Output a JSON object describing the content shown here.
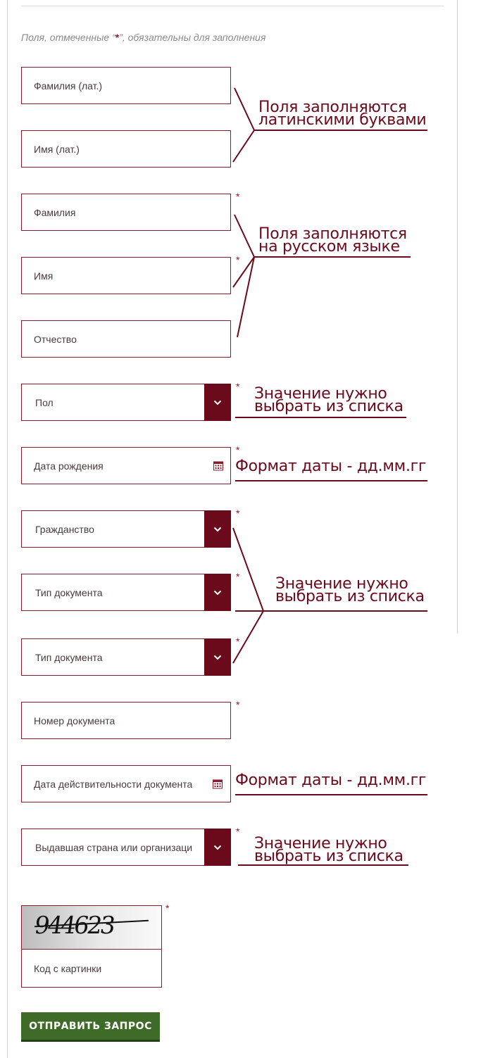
{
  "form": {
    "required_note_prefix": "Поля, отмеченные “",
    "required_note_star": "*",
    "required_note_suffix": "”, обязательны для заполнения",
    "required_marker": "*",
    "fields": {
      "last_name_lat": {
        "label": "Фамилия (лат.)",
        "required": false
      },
      "first_name_lat": {
        "label": "Имя (лат.)",
        "required": false
      },
      "last_name": {
        "label": "Фамилия",
        "required": true
      },
      "first_name": {
        "label": "Имя",
        "required": true
      },
      "patronymic": {
        "label": "Отчество",
        "required": false
      },
      "sex": {
        "label": "Пол",
        "required": true,
        "type": "select"
      },
      "birth_date": {
        "label": "Дата рождения",
        "required": true,
        "type": "date"
      },
      "citizenship": {
        "label": "Гражданство",
        "required": true,
        "type": "select"
      },
      "doc_type_1": {
        "label": "Тип документа",
        "required": true,
        "type": "select"
      },
      "doc_type_2": {
        "label": "Тип документа",
        "required": true,
        "type": "select"
      },
      "doc_number": {
        "label": "Номер документа",
        "required": true
      },
      "doc_valid_date": {
        "label": "Дата действительности документа",
        "required": false,
        "type": "date"
      },
      "issuing_country": {
        "label": "Выдавшая страна или организаци",
        "required": true,
        "type": "select"
      },
      "captcha_code": {
        "label": "Код с картинки",
        "required": true
      }
    },
    "captcha_image_text": "944623",
    "submit_label": "ОТПРАВИТЬ ЗАПРОС"
  },
  "annotations": {
    "latin": [
      "Поля заполняются",
      "латинскими буквами"
    ],
    "russian": [
      "Поля заполняются",
      "на русском языке"
    ],
    "select_1": [
      "Значение нужно",
      "выбрать из списка"
    ],
    "date_1": "Формат даты - дд.мм.гг",
    "select_group": [
      "Значение нужно",
      "выбрать из списка"
    ],
    "date_2": "Формат даты - дд.мм.гг",
    "select_3": [
      "Значение нужно",
      "выбрать из списка"
    ]
  },
  "colors": {
    "accent": "#6b0a1a",
    "border": "#8b1a2b",
    "submit": "#3e6b27"
  }
}
